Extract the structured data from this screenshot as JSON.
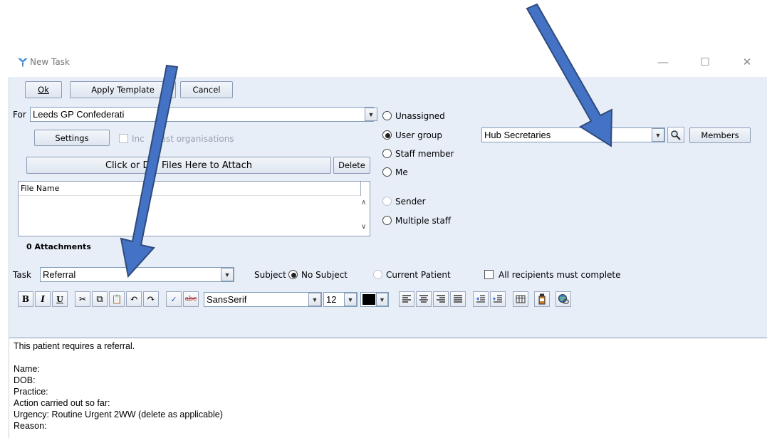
{
  "window": {
    "title": "New Task",
    "controls": [
      "—",
      "☐",
      "✕"
    ]
  },
  "toolbar": {
    "ok_label": "Ok",
    "apply_template_label": "Apply Template",
    "cancel_label": "Cancel"
  },
  "for_row": {
    "label": "For",
    "value": "Leeds GP Confederati",
    "settings_label": "Settings",
    "include_past_label": "Inc    past organisations"
  },
  "attach": {
    "drop_label": "Click or D    Files Here to Attach",
    "delete_label": "Delete",
    "column_header": "File Name",
    "count_label": "0 Attachments"
  },
  "assign": {
    "options": [
      {
        "label": "Unassigned",
        "checked": false,
        "disabled": false
      },
      {
        "label": "User group",
        "checked": true,
        "disabled": false
      },
      {
        "label": "Staff member",
        "checked": false,
        "disabled": false
      },
      {
        "label": "Me",
        "checked": false,
        "disabled": false
      },
      {
        "label": "Sender",
        "checked": false,
        "disabled": true
      },
      {
        "label": "Multiple staff",
        "checked": false,
        "disabled": false
      }
    ],
    "group_value": "Hub Secretaries",
    "members_label": "Members"
  },
  "task_row": {
    "task_label": "Task",
    "task_value": "Referral",
    "subject_label": "Subject",
    "no_subject_label": "No Subject",
    "current_patient_label": "Current Patient",
    "all_recipients_label": "All recipients must complete"
  },
  "format_bar": {
    "bold": "B",
    "italic": "I",
    "underline": "U",
    "font_value": "SansSerif",
    "size_value": "12",
    "text_color": "#000000"
  },
  "editor_lines": [
    "This patient requires a referral.",
    "",
    "Name:",
    "DOB:",
    "Practice:",
    "Action carried out so far:",
    "Urgency: Routine Urgent 2WW (delete as applicable)",
    "Reason:"
  ],
  "colors": {
    "client_bg": "#e7eef8",
    "arrow_fill": "#4472c4",
    "arrow_stroke": "#2f4b7c"
  }
}
